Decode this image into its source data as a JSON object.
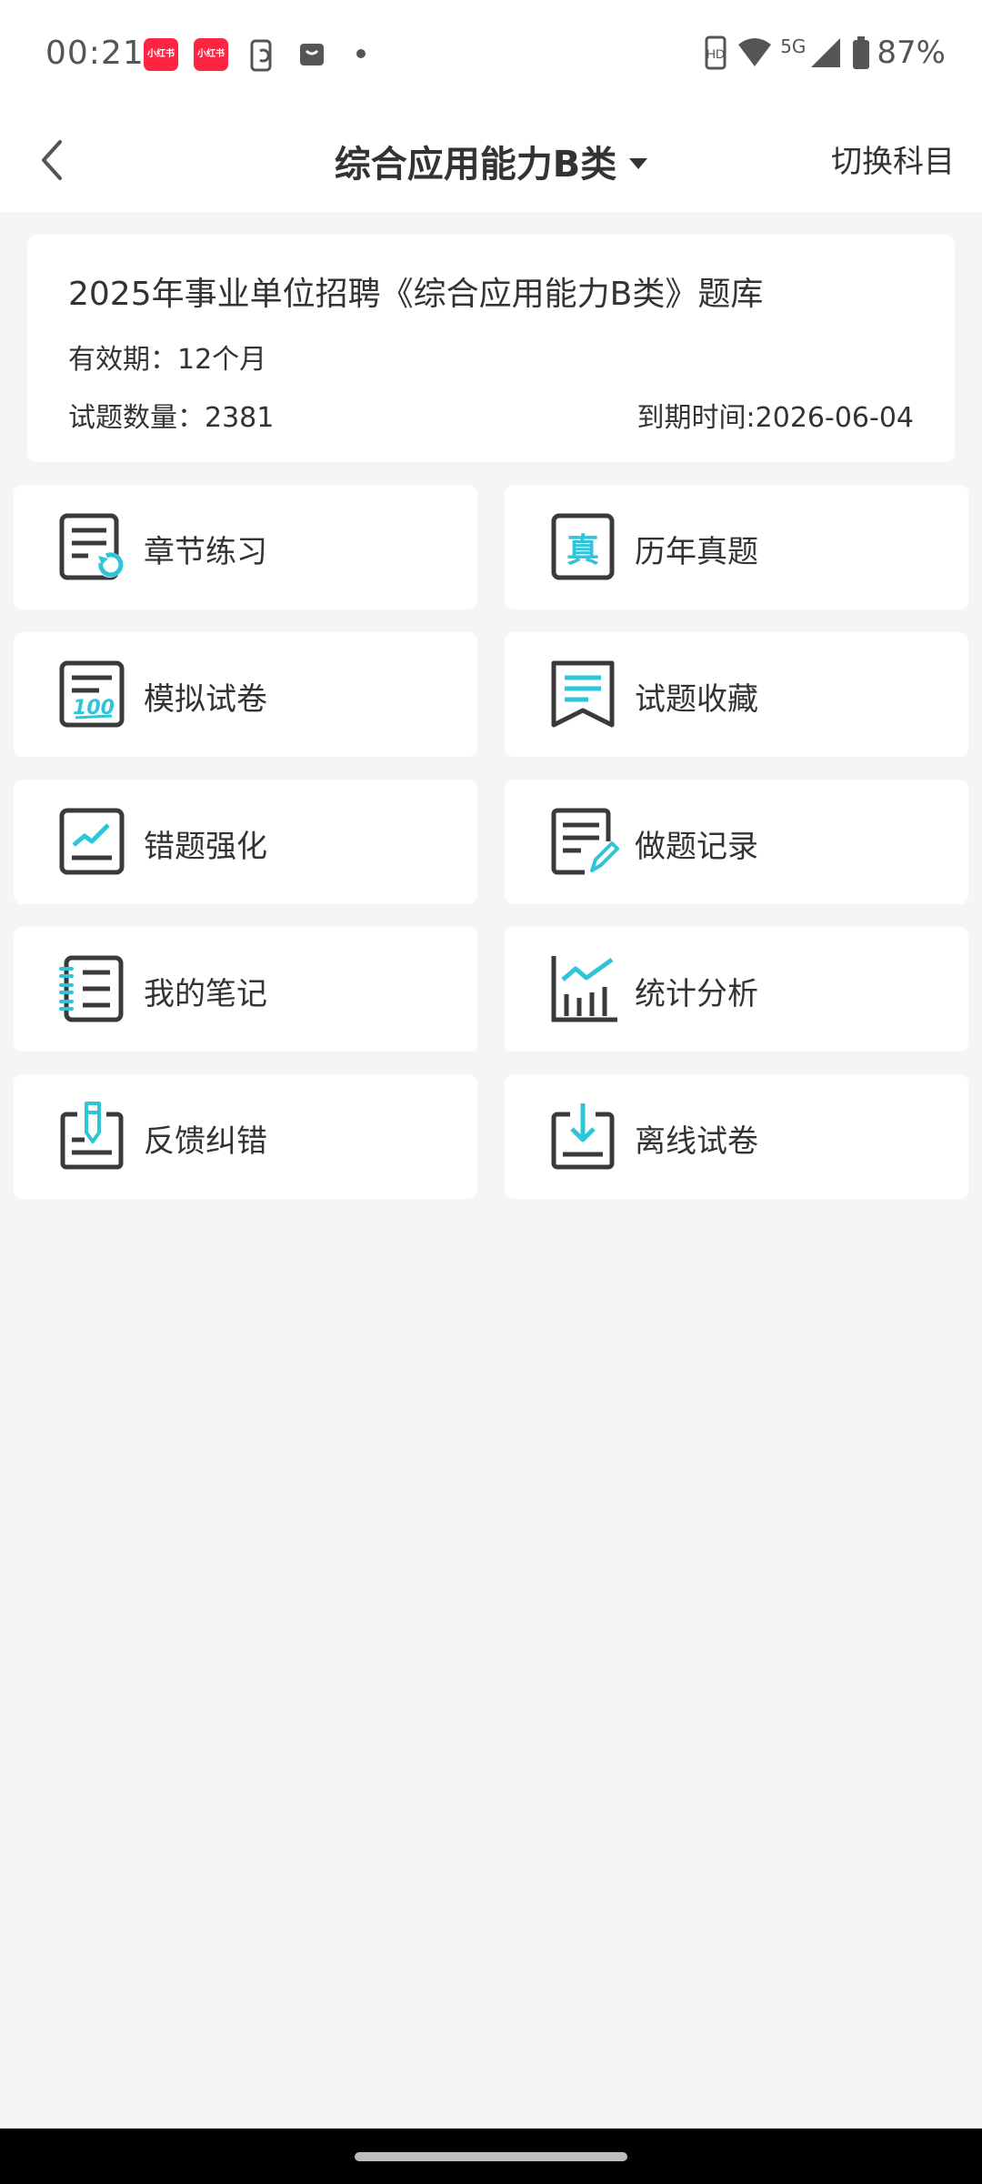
{
  "status_bar": {
    "time": "00:21",
    "notif_app_label": "小红书",
    "battery": "87%",
    "network": "5G"
  },
  "nav": {
    "title": "综合应用能力B类",
    "switch_label": "切换科目"
  },
  "info": {
    "title": "2025年事业单位招聘《综合应用能力B类》题库",
    "validity": "有效期：12个月",
    "count": "试题数量：2381",
    "expiry": "到期时间:2026-06-04"
  },
  "menu": [
    {
      "label": "章节练习",
      "icon": "chapter-practice-icon"
    },
    {
      "label": "历年真题",
      "icon": "past-exams-icon"
    },
    {
      "label": "模拟试卷",
      "icon": "mock-exam-icon"
    },
    {
      "label": "试题收藏",
      "icon": "favorites-icon"
    },
    {
      "label": "错题强化",
      "icon": "wrong-questions-icon"
    },
    {
      "label": "做题记录",
      "icon": "practice-record-icon"
    },
    {
      "label": "我的笔记",
      "icon": "my-notes-icon"
    },
    {
      "label": "统计分析",
      "icon": "statistics-icon"
    },
    {
      "label": "反馈纠错",
      "icon": "feedback-icon"
    },
    {
      "label": "离线试卷",
      "icon": "offline-download-icon"
    }
  ],
  "colors": {
    "accent": "#2ec5d9",
    "icon_stroke": "#3a3a3a",
    "brand_red": "#ff2442"
  }
}
